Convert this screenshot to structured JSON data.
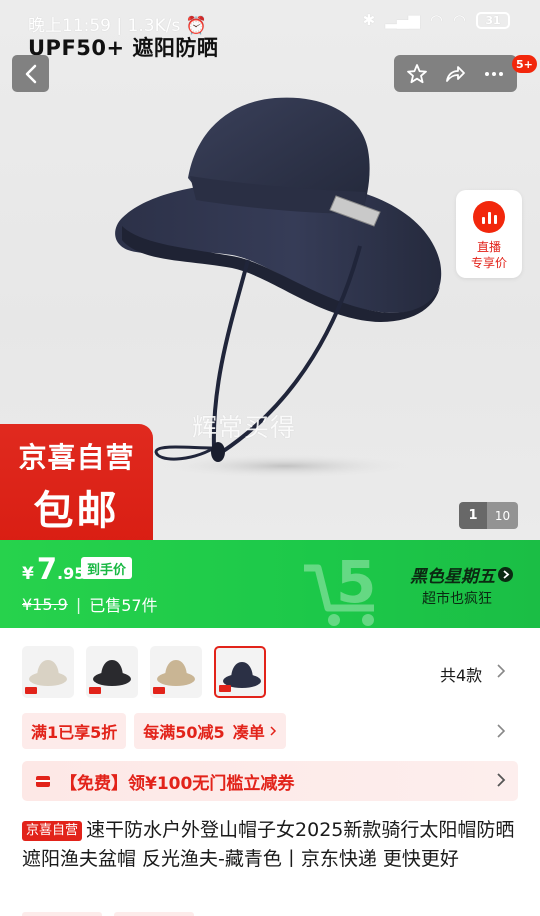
{
  "status_bar": {
    "time": "晚上11:59",
    "speed": "1.3K/s",
    "battery": "31"
  },
  "header": {
    "store_title": "UPF50+ 遮阳防晒",
    "badge_count": "5+",
    "icons": [
      "back-icon",
      "star-icon",
      "share-icon",
      "more-icon"
    ]
  },
  "live": {
    "line1": "直播",
    "line2": "专享价"
  },
  "hero": {
    "watermark": "辉常买得",
    "badge_line1": "京喜自营",
    "badge_line2": "包邮",
    "page_current": "1",
    "page_total": "10"
  },
  "price": {
    "currency": "¥",
    "integer": "7",
    "decimal": ".95",
    "tag": "到手价",
    "original": "¥15.9",
    "sold": "已售57件",
    "promo_title": "黑色星期五",
    "promo_sub": "超市也疯狂"
  },
  "variants": {
    "count_label": "共4款",
    "thumbs": [
      {
        "color": "#d9d2c4"
      },
      {
        "color": "#2a2a2e"
      },
      {
        "color": "#c9b594"
      },
      {
        "color": "#2b3045"
      }
    ],
    "selected_index": 3
  },
  "coupons": {
    "tag1": "满1已享5折",
    "tag2_a": "每满50减5",
    "tag2_b": "凑单"
  },
  "free_banner": {
    "text": "【免费】领¥100无门槛立减券"
  },
  "product": {
    "self_tag": "京喜自营",
    "title": "速干防水户外登山帽子女2025新款骑行太阳帽防晒遮阳渔夫盆帽 反光渔夫-藏青色丨京东快递 更快更好"
  },
  "colors": {
    "accent_red": "#e2231a",
    "price_green": "#1cc849",
    "hat_navy": "#2b3045"
  }
}
